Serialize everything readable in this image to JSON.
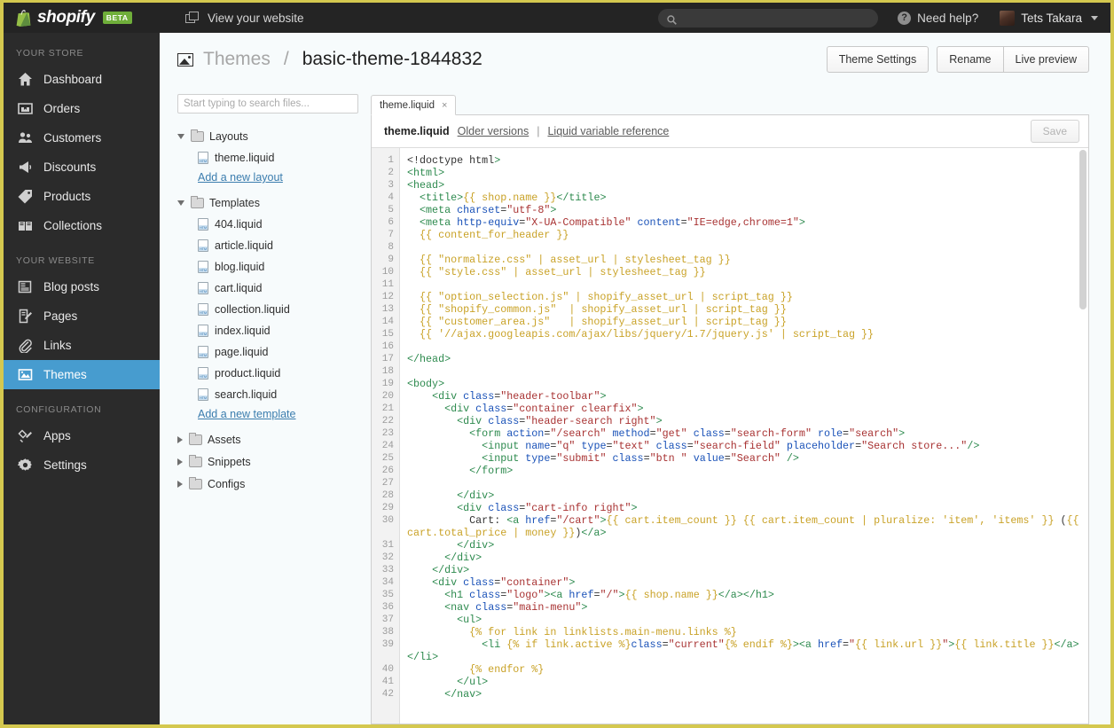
{
  "topbar": {
    "brand": "shopify",
    "beta": "BETA",
    "view_site": "View your website",
    "search_placeholder": "",
    "search_value": "",
    "need_help": "Need help?",
    "user_name": "Tets Takara"
  },
  "sidebar": {
    "sections": [
      {
        "label": "YOUR STORE",
        "items": [
          {
            "label": "Dashboard",
            "icon": "home-icon",
            "active": false
          },
          {
            "label": "Orders",
            "icon": "orders-icon",
            "active": false
          },
          {
            "label": "Customers",
            "icon": "customers-icon",
            "active": false
          },
          {
            "label": "Discounts",
            "icon": "megaphone-icon",
            "active": false
          },
          {
            "label": "Products",
            "icon": "tag-icon",
            "active": false
          },
          {
            "label": "Collections",
            "icon": "box-icon",
            "active": false
          }
        ]
      },
      {
        "label": "YOUR WEBSITE",
        "items": [
          {
            "label": "Blog posts",
            "icon": "newspaper-icon",
            "active": false
          },
          {
            "label": "Pages",
            "icon": "page-edit-icon",
            "active": false
          },
          {
            "label": "Links",
            "icon": "paperclip-icon",
            "active": false
          },
          {
            "label": "Themes",
            "icon": "image-icon",
            "active": true
          }
        ]
      },
      {
        "label": "CONFIGURATION",
        "items": [
          {
            "label": "Apps",
            "icon": "apps-icon",
            "active": false
          },
          {
            "label": "Settings",
            "icon": "gear-icon",
            "active": false
          }
        ]
      }
    ],
    "accent_color": "#479ccf",
    "background_color": "#2b2b2b"
  },
  "page": {
    "breadcrumb_parent": "Themes",
    "breadcrumb_sep": "/",
    "breadcrumb_current": "basic-theme-1844832",
    "actions": {
      "theme_settings": "Theme Settings",
      "rename": "Rename",
      "live_preview": "Live preview"
    }
  },
  "filepane": {
    "search_placeholder": "Start typing to search files...",
    "search_value": "",
    "groups": [
      {
        "name": "Layouts",
        "expanded": true,
        "files": [
          "theme.liquid"
        ],
        "add_link": "Add a new layout"
      },
      {
        "name": "Templates",
        "expanded": true,
        "files": [
          "404.liquid",
          "article.liquid",
          "blog.liquid",
          "cart.liquid",
          "collection.liquid",
          "index.liquid",
          "page.liquid",
          "product.liquid",
          "search.liquid"
        ],
        "add_link": "Add a new template"
      },
      {
        "name": "Assets",
        "expanded": false,
        "files": [],
        "add_link": ""
      },
      {
        "name": "Snippets",
        "expanded": false,
        "files": [],
        "add_link": ""
      },
      {
        "name": "Configs",
        "expanded": false,
        "files": [],
        "add_link": ""
      }
    ]
  },
  "editor": {
    "tab_label": "theme.liquid",
    "tab_close": "×",
    "toolbar": {
      "filename": "theme.liquid",
      "older_versions": "Older versions",
      "separator": "|",
      "liquid_reference": "Liquid variable reference",
      "save_label": "Save"
    },
    "first_line": 1,
    "last_line": 42,
    "line_numbers": [
      1,
      2,
      3,
      4,
      5,
      6,
      7,
      8,
      9,
      10,
      11,
      12,
      13,
      14,
      15,
      16,
      17,
      18,
      19,
      20,
      21,
      22,
      23,
      24,
      25,
      26,
      27,
      28,
      29,
      30,
      31,
      32,
      33,
      34,
      35,
      36,
      37,
      38,
      39,
      40,
      41,
      42
    ],
    "code_lines": [
      "<!doctype html>",
      "<html>",
      "<head>",
      "  <title>{{ shop.name }}</title>",
      "  <meta charset=\"utf-8\">",
      "  <meta http-equiv=\"X-UA-Compatible\" content=\"IE=edge,chrome=1\">",
      "  {{ content_for_header }}",
      "",
      "  {{ \"normalize.css\" | asset_url | stylesheet_tag }}",
      "  {{ \"style.css\" | asset_url | stylesheet_tag }}",
      "",
      "  {{ \"option_selection.js\" | shopify_asset_url | script_tag }}",
      "  {{ \"shopify_common.js\"  | shopify_asset_url | script_tag }}",
      "  {{ \"customer_area.js\"   | shopify_asset_url | script_tag }}",
      "  {{ '//ajax.googleapis.com/ajax/libs/jquery/1.7/jquery.js' | script_tag }}",
      "",
      "</head>",
      "",
      "<body>",
      "    <div class=\"header-toolbar\">",
      "      <div class=\"container clearfix\">",
      "        <div class=\"header-search right\">",
      "          <form action=\"/search\" method=\"get\" class=\"search-form\" role=\"search\">",
      "            <input name=\"q\" type=\"text\" class=\"search-field\" placeholder=\"Search store...\"/>",
      "            <input type=\"submit\" class=\"btn \" value=\"Search\" />",
      "          </form>",
      "",
      "        </div>",
      "        <div class=\"cart-info right\">",
      "          Cart: <a href=\"/cart\">{{ cart.item_count }} {{ cart.item_count | pluralize: 'item', 'items' }} ({{ cart.total_price | money }})</a>",
      "        </div>",
      "      </div>",
      "    </div>",
      "    <div class=\"container\">",
      "      <h1 class=\"logo\"><a href=\"/\">{{ shop.name }}</a></h1>",
      "      <nav class=\"main-menu\">",
      "        <ul>",
      "          {% for link in linklists.main-menu.links %}",
      "            <li {% if link.active %}class=\"current\"{% endif %}><a href=\"{{ link.url }}\">{{ link.title }}</a></li>",
      "          {% endfor %}",
      "        </ul>",
      "      </nav>"
    ]
  }
}
